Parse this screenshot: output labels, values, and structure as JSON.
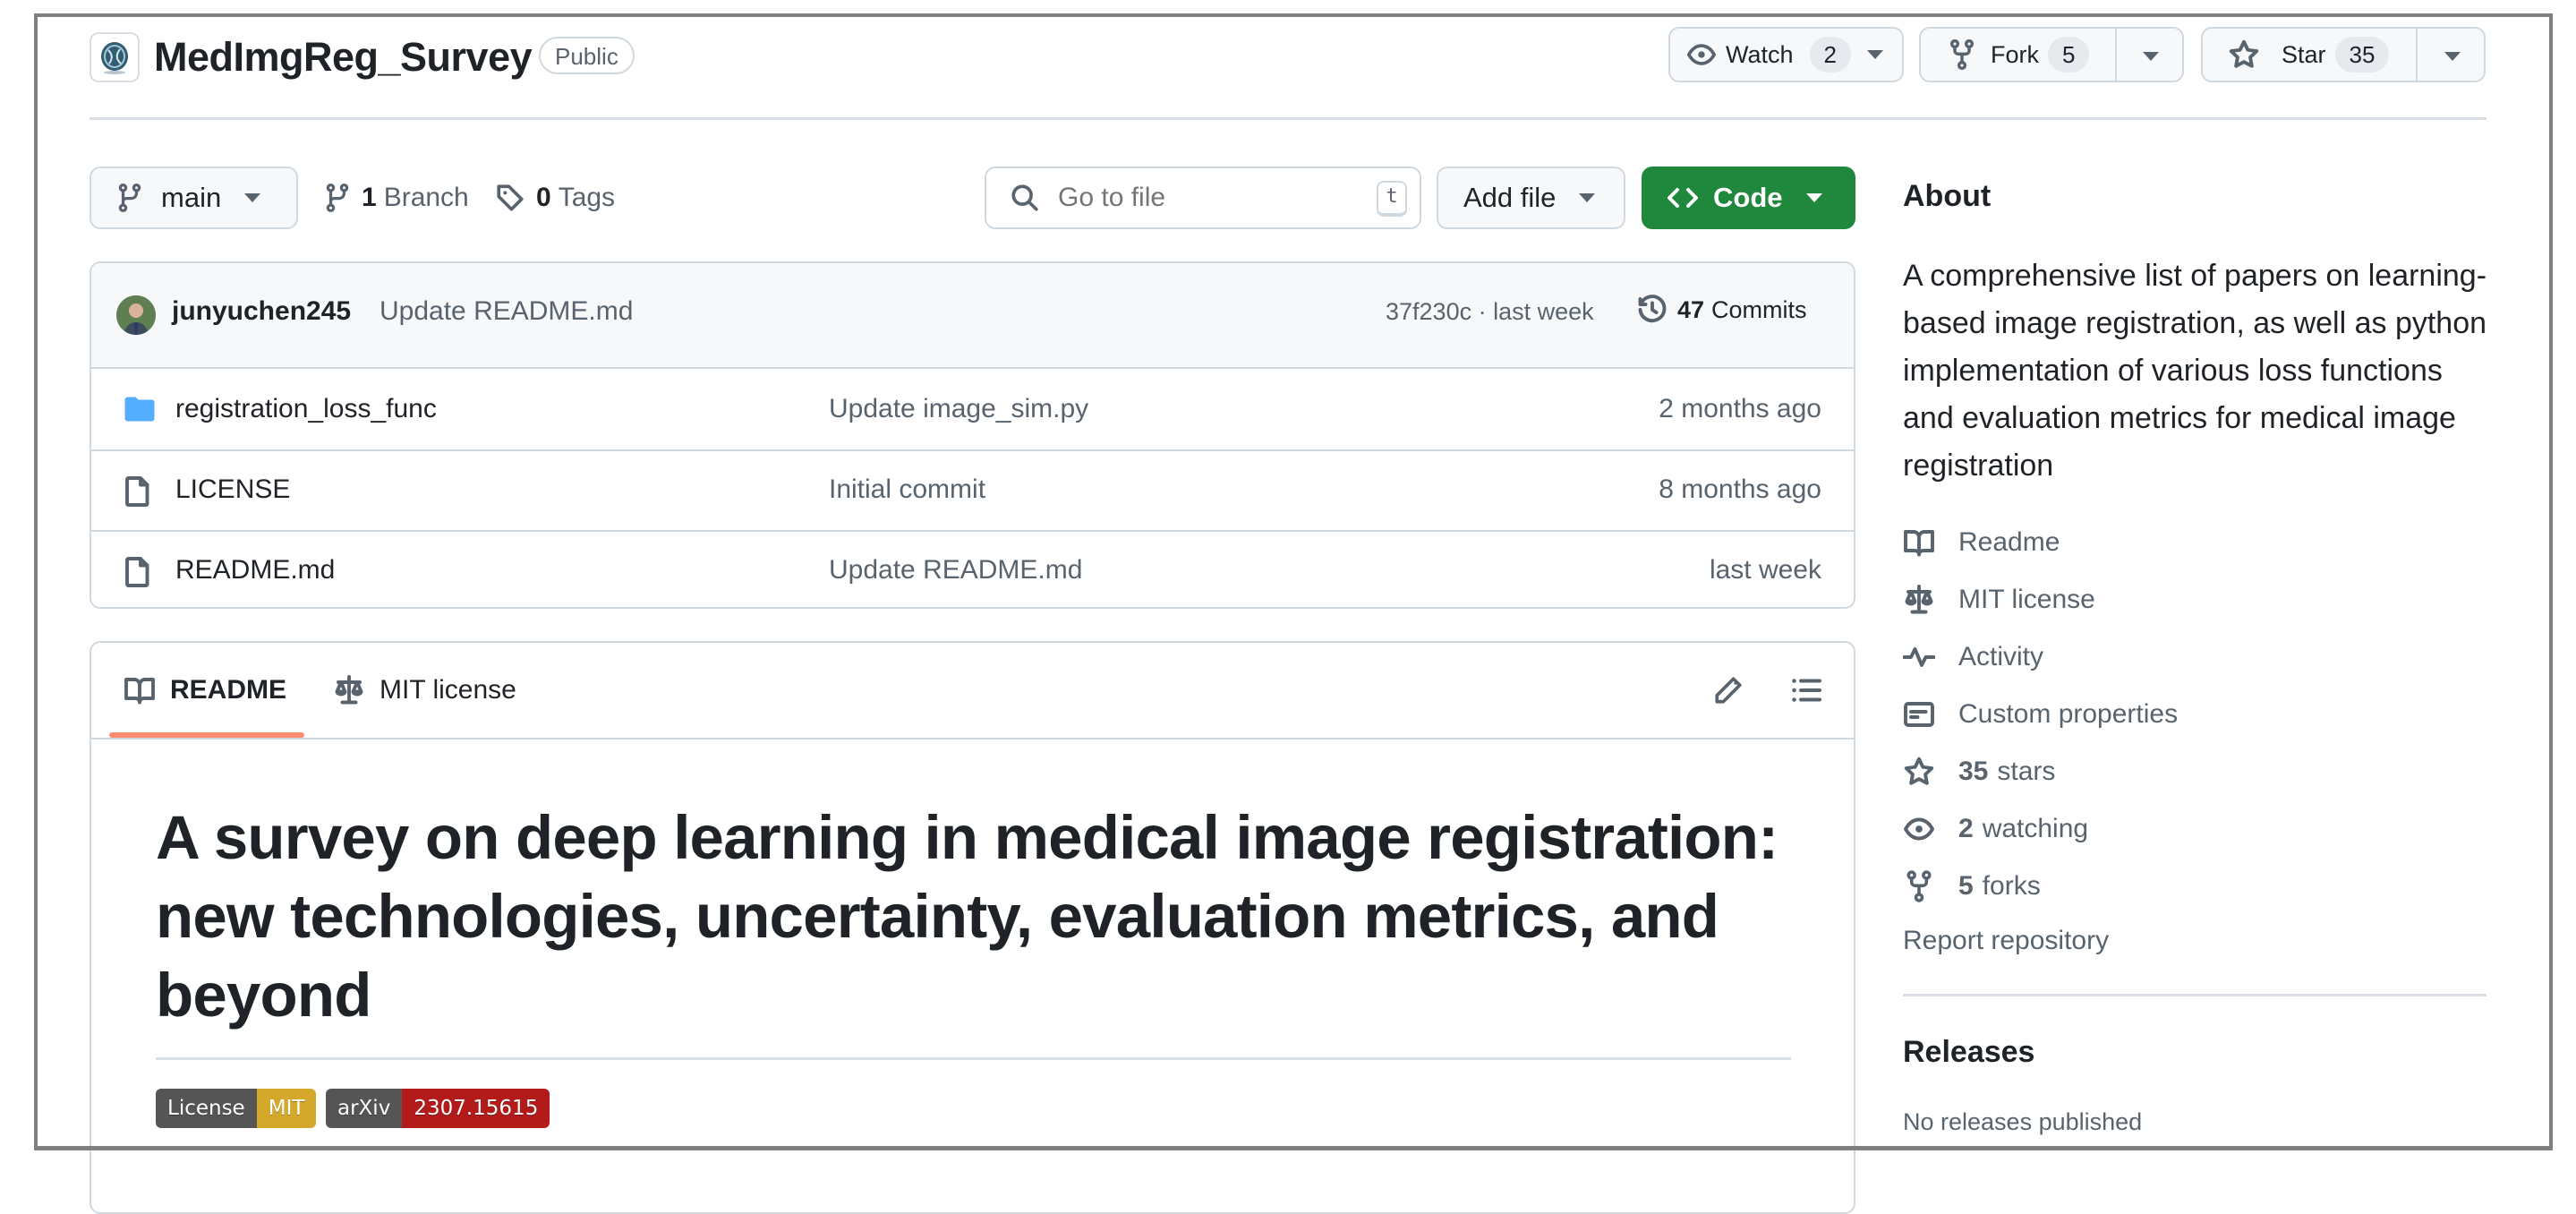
{
  "repo": {
    "name": "MedImgReg_Survey",
    "visibility": "Public",
    "actions": {
      "watch": {
        "label": "Watch",
        "count": "2"
      },
      "fork": {
        "label": "Fork",
        "count": "5"
      },
      "star": {
        "label": "Star",
        "count": "35"
      }
    }
  },
  "toolbar": {
    "branch": "main",
    "branches_count": "1",
    "branches_label": "Branch",
    "tags_count": "0",
    "tags_label": "Tags",
    "search_placeholder": "Go to file",
    "search_shortcut": "t",
    "add_file_label": "Add file",
    "code_label": "Code"
  },
  "latest_commit": {
    "author": "junyuchen245",
    "message": "Update README.md",
    "hash_time": "37f230c · last week",
    "commits_count": "47",
    "commits_label": "Commits"
  },
  "files": [
    {
      "name": "registration_loss_func",
      "type": "folder",
      "message": "Update image_sim.py",
      "age": "2 months ago"
    },
    {
      "name": "LICENSE",
      "type": "file",
      "message": "Initial commit",
      "age": "8 months ago"
    },
    {
      "name": "README.md",
      "type": "file",
      "message": "Update README.md",
      "age": "last week"
    }
  ],
  "readme": {
    "tabs": [
      {
        "label": "README",
        "active": true
      },
      {
        "label": "MIT license",
        "active": false
      }
    ],
    "heading": "A survey on deep learning in medical image registration: new technologies, uncertainty, evaluation metrics, and beyond",
    "badges": [
      {
        "left": "License",
        "right": "MIT",
        "color": "#d4a82a"
      },
      {
        "left": "arXiv",
        "right": "2307.15615",
        "color": "#b31b1b"
      }
    ]
  },
  "sidebar": {
    "about_title": "About",
    "description": "A comprehensive list of papers on learning-based image registration, as well as python implementation of various loss functions and evaluation metrics for medical image registration",
    "links": [
      {
        "icon": "book-icon",
        "label": "Readme"
      },
      {
        "icon": "law-icon",
        "label": "MIT license"
      },
      {
        "icon": "pulse-icon",
        "label": "Activity"
      },
      {
        "icon": "note-icon",
        "label": "Custom properties"
      },
      {
        "icon": "star-icon",
        "count": "35",
        "label": "stars"
      },
      {
        "icon": "eye-icon",
        "count": "2",
        "label": "watching"
      },
      {
        "icon": "fork-icon",
        "count": "5",
        "label": "forks"
      }
    ],
    "report_label": "Report repository",
    "releases_title": "Releases",
    "releases_empty": "No releases published"
  },
  "colors": {
    "primary_button": "#1f883d",
    "active_tab_underline": "#fd8c73",
    "folder_icon": "#54aeff",
    "muted_text": "#59636e"
  }
}
